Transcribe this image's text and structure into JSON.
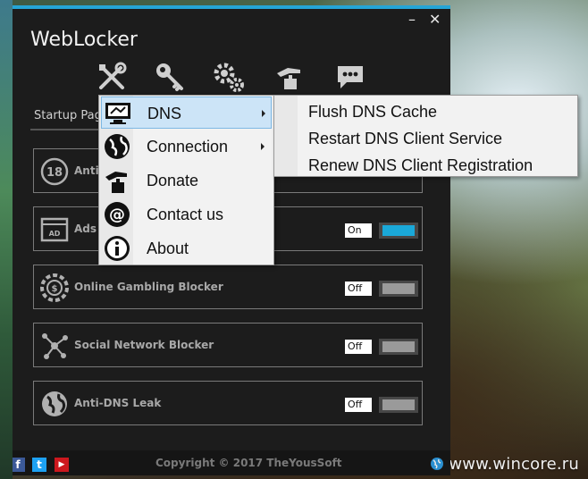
{
  "app": {
    "title": "WebLocker",
    "minimize": "–",
    "close": "✕"
  },
  "toolbar": {
    "icons": [
      "tools-icon",
      "key-icon",
      "gears-icon",
      "donate-hand-icon",
      "chat-bubble-icon"
    ]
  },
  "tabs": {
    "startup": "Startup Page"
  },
  "blocks": [
    {
      "name": "Anti-",
      "state": "",
      "on": false,
      "icon": "18-plus-icon"
    },
    {
      "name": "Ads",
      "state": "On",
      "on": true,
      "icon": "ad-window-icon"
    },
    {
      "name": "Online Gambling Blocker",
      "state": "Off",
      "on": false,
      "icon": "casino-chip-icon"
    },
    {
      "name": "Social Network Blocker",
      "state": "Off",
      "on": false,
      "icon": "network-nodes-icon"
    },
    {
      "name": "Anti-DNS Leak",
      "state": "Off",
      "on": false,
      "icon": "globe-icon"
    }
  ],
  "menu": {
    "items": [
      {
        "label": "DNS",
        "has_submenu": true,
        "highlighted": true,
        "icon": "monitor-icon"
      },
      {
        "label": "Connection",
        "has_submenu": true,
        "highlighted": false,
        "icon": "globe-icon"
      },
      {
        "label": "Donate",
        "has_submenu": false,
        "highlighted": false,
        "icon": "donate-hand-icon"
      },
      {
        "label": "Contact us",
        "has_submenu": false,
        "highlighted": false,
        "icon": "at-sign-icon"
      },
      {
        "label": "About",
        "has_submenu": false,
        "highlighted": false,
        "icon": "info-icon"
      }
    ]
  },
  "submenu": {
    "items": [
      {
        "label": "Flush DNS Cache"
      },
      {
        "label": "Restart DNS Client Service"
      },
      {
        "label": "Renew DNS Client Registration"
      }
    ]
  },
  "footer": {
    "copyright": "Copyright © 2017 TheYousSoft",
    "facebook": "f",
    "twitter": "t",
    "youtube": "▶"
  },
  "watermark": "www.wincore.ru",
  "colors": {
    "accent": "#25a5d6",
    "toggle_on": "#1aa8d8",
    "menu_highlight": "#cce4f7",
    "window_bg": "#1c1c1c"
  }
}
